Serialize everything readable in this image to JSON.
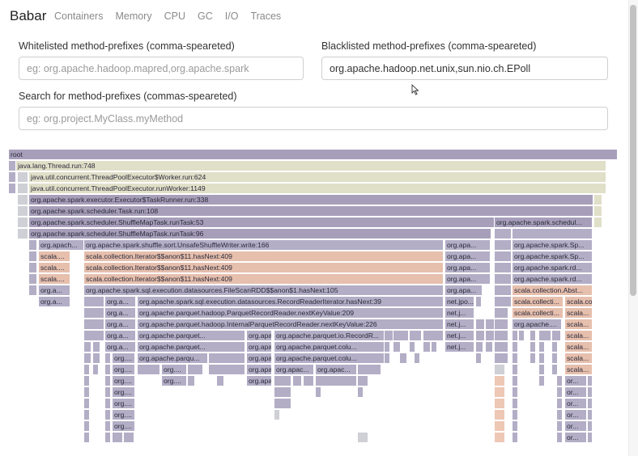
{
  "app": {
    "brand": "Babar"
  },
  "nav": [
    {
      "label": "Containers"
    },
    {
      "label": "Memory"
    },
    {
      "label": "CPU"
    },
    {
      "label": "GC"
    },
    {
      "label": "I/O"
    },
    {
      "label": "Traces"
    }
  ],
  "whitelist": {
    "label": "Whitelisted method-prefixes (comma-speareted)",
    "placeholder": "eg: org.apache.hadoop.mapred,org.apache.spark",
    "value": ""
  },
  "blacklist": {
    "label": "Blacklisted method-prefixes (comma-speareted)",
    "placeholder": "",
    "value": "org.apache.hadoop.net.unix,sun.nio.ch.EPoll"
  },
  "search": {
    "label": "Search for method-prefixes (commas-speareted)",
    "placeholder": "eg: org.project.MyClass.myMethod",
    "value": ""
  },
  "flame_frames": [
    {
      "name": "frame-root",
      "label": "root"
    },
    {
      "name": "frame-thread-run",
      "label": "java.lang.Thread.run:748"
    },
    {
      "name": "frame-worker-run",
      "label": "java.util.concurrent.ThreadPoolExecutor$Worker.run:624"
    },
    {
      "name": "frame-run-worker",
      "label": "java.util.concurrent.ThreadPoolExecutor.runWorker:1149"
    },
    {
      "name": "frame-task-runner",
      "label": "org.apache.spark.executor.Executor$TaskRunner.run:338"
    },
    {
      "name": "frame-task-run",
      "label": "org.apache.spark.scheduler.Task.run:108"
    },
    {
      "name": "frame-shuffle-map-53",
      "label": "org.apache.spark.scheduler.ShuffleMapTask.runTask:53"
    },
    {
      "name": "frame-shuffle-sched-r",
      "label": "org.apache.spark.schedul..."
    },
    {
      "name": "frame-shuffle-map-96",
      "label": "org.apache.spark.scheduler.ShuffleMapTask.runTask:96"
    },
    {
      "name": "frame-apach-1",
      "label": "org.apach..."
    },
    {
      "name": "frame-unsafe-shuffle",
      "label": "org.apache.spark.shuffle.sort.UnsafeShuffleWriter.write:166"
    },
    {
      "name": "frame-apa-1",
      "label": "org.apa..."
    },
    {
      "name": "frame-spark-sp-1",
      "label": "org.apache.spark.Sp..."
    },
    {
      "name": "frame-scala-1",
      "label": "scala...."
    },
    {
      "name": "frame-iter-anon-1",
      "label": "scala.collection.Iterator$$anon$11.hasNext:409"
    },
    {
      "name": "frame-apa-2",
      "label": "org.apa..."
    },
    {
      "name": "frame-spark-sp-2",
      "label": "org.apache.spark.Sp..."
    },
    {
      "name": "frame-scala-2",
      "label": "scala...."
    },
    {
      "name": "frame-iter-anon-2",
      "label": "scala.collection.Iterator$$anon$11.hasNext:409"
    },
    {
      "name": "frame-apa-3",
      "label": "org.apa..."
    },
    {
      "name": "frame-spark-rd-1",
      "label": "org.apache.spark.rd..."
    },
    {
      "name": "frame-scala-3",
      "label": "scala...."
    },
    {
      "name": "frame-iter-anon-3",
      "label": "scala.collection.Iterator$$anon$11.hasNext:409"
    },
    {
      "name": "frame-apa-4",
      "label": "org.apa..."
    },
    {
      "name": "frame-spark-rd-2",
      "label": "org.apache.spark.rd..."
    },
    {
      "name": "frame-org-a-1",
      "label": "org.a..."
    },
    {
      "name": "frame-scan-rdd",
      "label": "org.apache.spark.sql.execution.datasources.FileScanRDD$$anon$1.hasNext:105"
    },
    {
      "name": "frame-apa-5",
      "label": "org.apa..."
    },
    {
      "name": "frame-scala-abst",
      "label": "scala.collection.Abst..."
    },
    {
      "name": "frame-org-a-2",
      "label": "org.a..."
    },
    {
      "name": "frame-org-a-3",
      "label": "org.a..."
    },
    {
      "name": "frame-record-reader-iter",
      "label": "org.apache.spark.sql.execution.datasources.RecordReaderIterator.hasNext:39"
    },
    {
      "name": "frame-net-jpo",
      "label": "net.jpo..."
    },
    {
      "name": "frame-scala-collecti-1",
      "label": "scala.collecti..."
    },
    {
      "name": "frame-scala-collection-iter",
      "label": "scala.collection.Itera..."
    },
    {
      "name": "frame-org-a-4",
      "label": "org.a..."
    },
    {
      "name": "frame-parquet-reader-209",
      "label": "org.apache.parquet.hadoop.ParquetRecordReader.nextKeyValue:209"
    },
    {
      "name": "frame-net-j-1",
      "label": "net.j..."
    },
    {
      "name": "frame-scala-collecti-2",
      "label": "scala.collecti..."
    },
    {
      "name": "frame-scala-1b",
      "label": "scala..."
    },
    {
      "name": "frame-org-a-5",
      "label": "org.a..."
    },
    {
      "name": "frame-internal-parquet",
      "label": "org.apache.parquet.hadoop.InternalParquetRecordReader.nextKeyValue:226"
    },
    {
      "name": "frame-net-j-2",
      "label": "net.j..."
    },
    {
      "name": "frame-org-apache-dots",
      "label": "org.apache...."
    },
    {
      "name": "frame-scala-2b",
      "label": "scala..."
    },
    {
      "name": "frame-org-a-6",
      "label": "org.a..."
    },
    {
      "name": "frame-parquet-dots-1",
      "label": "org.apache.parquet..."
    },
    {
      "name": "frame-org-apach-1",
      "label": "org.apach..."
    },
    {
      "name": "frame-parquet-io-record",
      "label": "org.apache.parquet.io.RecordR..."
    },
    {
      "name": "frame-net-j-3",
      "label": "net.j..."
    },
    {
      "name": "frame-scala-3b",
      "label": "scala..."
    },
    {
      "name": "frame-org-a-7",
      "label": "org.a..."
    },
    {
      "name": "frame-parquet-dots-2",
      "label": "org.apache.parquet..."
    },
    {
      "name": "frame-org-apach-2",
      "label": "org.apach..."
    },
    {
      "name": "frame-parquet-colu",
      "label": "org.apache.parquet.colu..."
    },
    {
      "name": "frame-net-j-4",
      "label": "net.j..."
    },
    {
      "name": "frame-scala-4b",
      "label": "scala..."
    },
    {
      "name": "frame-org-1",
      "label": "org...."
    },
    {
      "name": "frame-parquet-dots-3",
      "label": "org.apache.parqu..."
    },
    {
      "name": "frame-org-apach-3",
      "label": "org.apach..."
    },
    {
      "name": "frame-parquet-colu-2",
      "label": "org.apache.parquet.colu..."
    },
    {
      "name": "frame-scala-5b",
      "label": "scala..."
    },
    {
      "name": "frame-org-2",
      "label": "org...."
    },
    {
      "name": "frame-org-3",
      "label": "org...."
    },
    {
      "name": "frame-org-apach-4",
      "label": "org.apach..."
    },
    {
      "name": "frame-org-apac-1",
      "label": "org.apac..."
    },
    {
      "name": "frame-org-apac-2",
      "label": "org.apac..."
    },
    {
      "name": "frame-scala-6b",
      "label": "scala..."
    },
    {
      "name": "frame-org-4",
      "label": "org...."
    },
    {
      "name": "frame-org-5",
      "label": "org...."
    },
    {
      "name": "frame-org-apach-5",
      "label": "org.apach..."
    },
    {
      "name": "frame-or-1",
      "label": "or..."
    },
    {
      "name": "frame-org-6",
      "label": "org...."
    },
    {
      "name": "frame-or-2",
      "label": "or..."
    },
    {
      "name": "frame-org-7",
      "label": "org...."
    },
    {
      "name": "frame-or-3",
      "label": "or..."
    },
    {
      "name": "frame-org-8",
      "label": "org...."
    },
    {
      "name": "frame-or-4",
      "label": "or..."
    },
    {
      "name": "frame-org-9",
      "label": "org...."
    },
    {
      "name": "frame-or-5",
      "label": "or..."
    },
    {
      "name": "frame-or-6",
      "label": "or..."
    }
  ]
}
